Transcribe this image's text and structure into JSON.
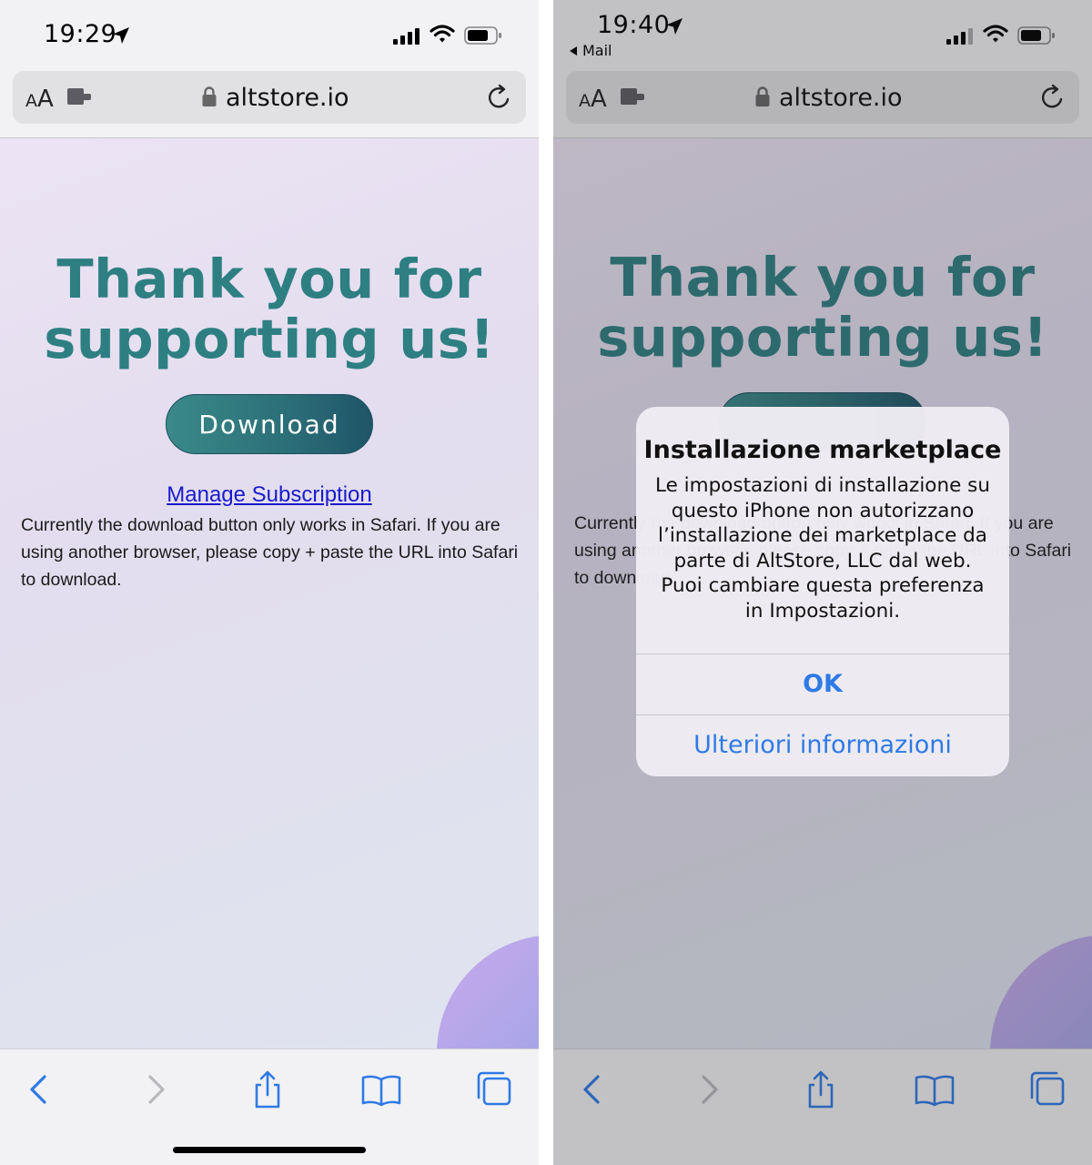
{
  "left_screen": {
    "status": {
      "time": "19:29"
    },
    "url_bar": {
      "aa": "AA",
      "url": "altstore.io"
    },
    "page": {
      "headline_line1": "Thank you for",
      "headline_line2": "supporting us!",
      "download_label": "Download",
      "manage_link": "Manage Subscription",
      "info_text": "Currently the download button only works in Safari. If you are using another browser, please copy + paste the URL into Safari to download."
    }
  },
  "right_screen": {
    "status": {
      "time": "19:40",
      "back_app": "Mail"
    },
    "url_bar": {
      "aa": "AA",
      "url": "altstore.io"
    },
    "page": {
      "headline_line1": "Thank you for",
      "headline_line2": "supporting us!",
      "info_text": "Currently the download button only works in Safari. If you are using another browser, please copy + paste the URL into Safari to download."
    },
    "alert": {
      "title": "Installazione marketplace",
      "message": "Le impostazioni di installazione su questo iPhone non autorizzano l’installazione dei marketplace da parte di AltStore, LLC dal web. Puoi cambiare questa preferenza in Impostazioni.",
      "ok_label": "OK",
      "more_label": "Ulteriori informazioni"
    }
  },
  "toolbar_icons": [
    "back-chevron-icon",
    "forward-chevron-icon",
    "share-icon",
    "bookmarks-icon",
    "tabs-icon"
  ],
  "colors": {
    "headline": "#2e7f82",
    "button": "#2b6e78",
    "link": "#1a1acc",
    "ios_blue": "#2f7ae5"
  }
}
